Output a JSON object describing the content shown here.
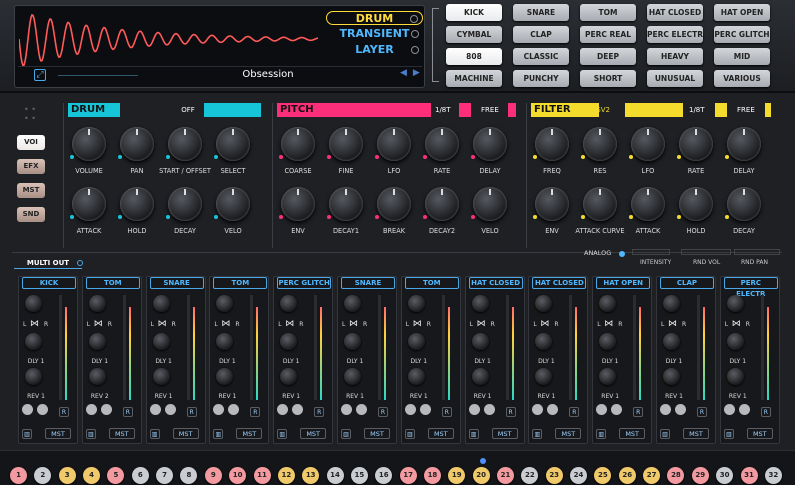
{
  "layers": {
    "items": [
      {
        "label": "DRUM",
        "active": true
      },
      {
        "label": "TRANSIENT",
        "active": false
      },
      {
        "label": "LAYER",
        "active": false
      }
    ]
  },
  "preset": {
    "name": "Obsession"
  },
  "categories": [
    {
      "label": "KICK",
      "sel": true
    },
    {
      "label": "SNARE"
    },
    {
      "label": "TOM"
    },
    {
      "label": "HAT CLOSED"
    },
    {
      "label": "HAT OPEN"
    },
    {
      "label": "CYMBAL"
    },
    {
      "label": "CLAP"
    },
    {
      "label": "PERC REAL"
    },
    {
      "label": "PERC ELECTR"
    },
    {
      "label": "PERC GLITCH"
    },
    {
      "label": "808",
      "sel": true
    },
    {
      "label": "CLASSIC"
    },
    {
      "label": "DEEP"
    },
    {
      "label": "HEAVY"
    },
    {
      "label": "MID"
    },
    {
      "label": "MACHINE"
    },
    {
      "label": "PUNCHY"
    },
    {
      "label": "SHORT"
    },
    {
      "label": "UNUSUAL"
    },
    {
      "label": "VARIOUS"
    }
  ],
  "sidebar": {
    "items": [
      {
        "label": "VOI",
        "sel": true
      },
      {
        "label": "EFX"
      },
      {
        "label": "MST"
      },
      {
        "label": "SND"
      }
    ]
  },
  "drum": {
    "title": "DRUM",
    "toggle": "OFF",
    "color": "#16c5d8",
    "knobs": [
      "VOLUME",
      "PAN",
      "START / OFFSET",
      "SELECT",
      "ATTACK",
      "HOLD",
      "DECAY",
      "VELO"
    ]
  },
  "pitch": {
    "title": "PITCH",
    "mode": "1/8T",
    "free": "FREE",
    "color": "#ff2e7a",
    "knobs": [
      "COARSE",
      "FINE",
      "LFO",
      "RATE",
      "DELAY",
      "ENV",
      "DECAY1",
      "BREAK",
      "DECAY2",
      "VELO"
    ]
  },
  "filter": {
    "title": "FILTER",
    "type": "LPF.SV2",
    "mode": "1/8T",
    "free": "FREE",
    "color": "#f4dc2c",
    "knobs": [
      "FREQ",
      "RES",
      "LFO",
      "RATE",
      "DELAY",
      "ENV",
      "ATTACK CURVE",
      "ATTACK",
      "HOLD",
      "DECAY"
    ]
  },
  "analog": {
    "label": "ANALOG",
    "intensity": "INTENSITY",
    "rnd_vol": "RND VOL",
    "rnd_pan": "RND PAN"
  },
  "multi_out": {
    "label": "MULTI OUT"
  },
  "channels": [
    {
      "name": "KICK",
      "rev": "REV 1"
    },
    {
      "name": "TOM",
      "rev": "REV 2"
    },
    {
      "name": "SNARE",
      "rev": "REV 1"
    },
    {
      "name": "TOM",
      "rev": "REV 1"
    },
    {
      "name": "PERC GLITCH",
      "rev": "REV 1"
    },
    {
      "name": "SNARE",
      "rev": "REV 1"
    },
    {
      "name": "TOM",
      "rev": "REV 1"
    },
    {
      "name": "HAT CLOSED",
      "rev": "REV 1"
    },
    {
      "name": "HAT CLOSED",
      "rev": "REV 1"
    },
    {
      "name": "HAT OPEN",
      "rev": "REV 1"
    },
    {
      "name": "CLAP",
      "rev": "REV 1"
    },
    {
      "name": "PERC ELECTR",
      "rev": "REV 1"
    }
  ],
  "channel_common": {
    "l": "L",
    "r": "R",
    "dly": "DLY 1",
    "mst": "MST",
    "r_btn": "R"
  },
  "pads": {
    "labels": [
      "1",
      "2",
      "3",
      "4",
      "5",
      "6",
      "7",
      "8",
      "9",
      "10",
      "11",
      "12",
      "13",
      "14",
      "15",
      "16",
      "17",
      "18",
      "19",
      "20",
      "21",
      "22",
      "23",
      "24",
      "25",
      "26",
      "27",
      "28",
      "29",
      "30",
      "31",
      "32"
    ],
    "colors": [
      "#f29aa0",
      "#c9ccd1",
      "#f0c96b",
      "#f0c96b",
      "#f29aa0",
      "#c9ccd1",
      "#c9ccd1",
      "#c9ccd1",
      "#f29aa0",
      "#f29aa0",
      "#f29aa0",
      "#f0c96b",
      "#f0c96b",
      "#c9ccd1",
      "#c9ccd1",
      "#c9ccd1",
      "#f29aa0",
      "#f29aa0",
      "#f0c96b",
      "#f0c96b",
      "#f29aa0",
      "#c9ccd1",
      "#f0c96b",
      "#c9ccd1",
      "#f0c96b",
      "#f0c96b",
      "#f0c96b",
      "#f29aa0",
      "#f29aa0",
      "#c9ccd1",
      "#f29aa0",
      "#c9ccd1"
    ]
  }
}
